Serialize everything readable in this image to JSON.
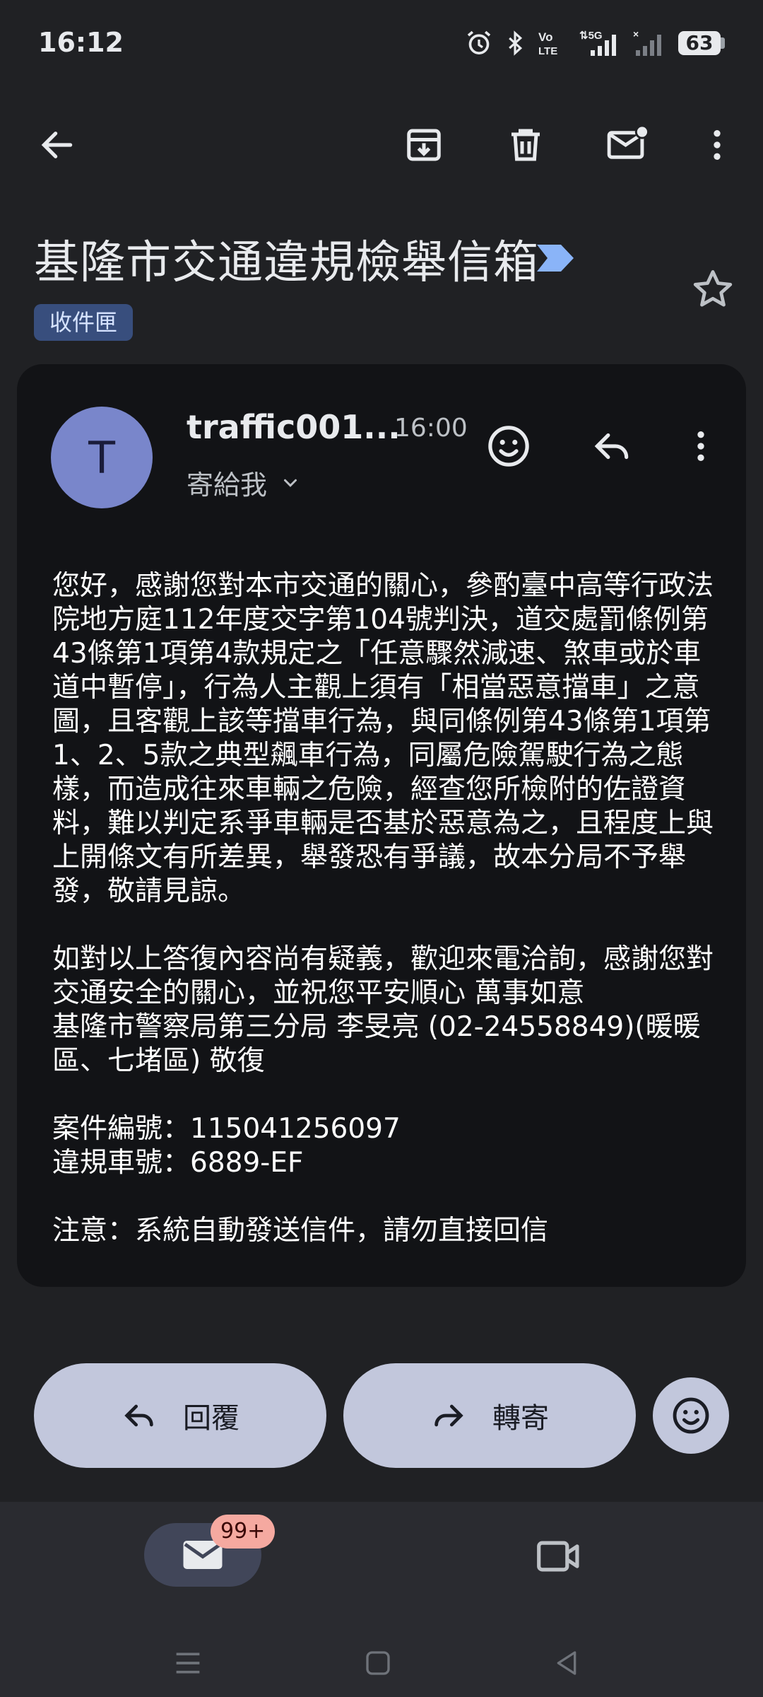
{
  "status_bar": {
    "time": "16:12",
    "icons": [
      "alarm-icon",
      "bluetooth-icon",
      "volte-icon",
      "signal-5g-icon",
      "signal-icon",
      "battery-icon"
    ],
    "volte_label": "Vo\nLTE",
    "network_label": "5G",
    "battery_level": "63"
  },
  "toolbar": {
    "back": "arrow-back-icon",
    "archive": "archive-icon",
    "delete": "delete-icon",
    "mark_unread": "mark-unread-icon",
    "more": "more-vert-icon"
  },
  "subject": "基隆市交通違規檢舉信箱",
  "label_chip": "收件匣",
  "message": {
    "avatar_letter": "T",
    "avatar_color": "#7986cb",
    "sender": "traffic001...",
    "time": "16:00",
    "recipient": "寄給我",
    "paragraphs": [
      "您好，感謝您對本市交通的關心，參酌臺中高等行政法院地方庭112年度交字第104號判決，道交處罰條例第43條第1項第4款規定之「任意驟然減速、煞車或於車道中暫停」，行為人主觀上須有「相當惡意擋車」之意圖，且客觀上該等擋車行為，與同條例第43條第1項第1、2、5款之典型飆車行為，同屬危險駕駛行為之態樣，而造成往來車輛之危險，經查您所檢附的佐證資料，難以判定系爭車輛是否基於惡意為之，且程度上與上開條文有所差異，舉發恐有爭議，故本分局不予舉發，敬請見諒。",
      "如對以上答復內容尚有疑義，歡迎來電洽詢，感謝您對交通安全的關心，並祝您平安順心 萬事如意\n基隆市警察局第三分局 李旻亮 (02-24558849)(暖暖區、七堵區) 敬復",
      "案件編號：115041256097\n違規車號：6889-EF",
      "注意：系統自動發送信件，請勿直接回信"
    ]
  },
  "actions": {
    "reply": "回覆",
    "forward": "轉寄"
  },
  "bottom_nav": {
    "mail_badge": "99+",
    "items": [
      "mail-icon",
      "video-camera-icon"
    ]
  },
  "colors": {
    "background": "#202124",
    "card": "#121316",
    "pill": "#c2c7dc",
    "chip": "#384e7d",
    "important": "#8ab4f8",
    "badge": "#f5a9a0"
  }
}
